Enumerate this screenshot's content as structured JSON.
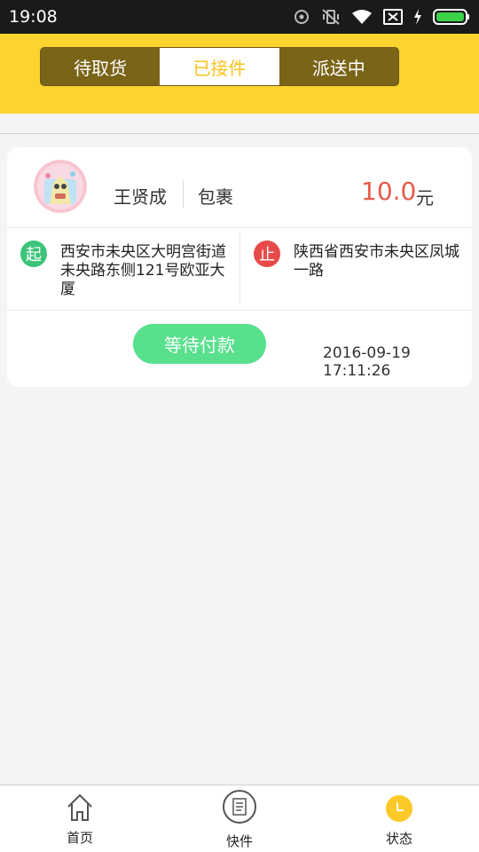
{
  "status_bar": {
    "time": "19:08"
  },
  "tabs": [
    {
      "label": "待取货",
      "active": false
    },
    {
      "label": "已接件",
      "active": true
    },
    {
      "label": "派送中",
      "active": false
    }
  ],
  "order": {
    "name": "王贤成",
    "type": "包裹",
    "price": "10.0",
    "unit": "元",
    "start_badge": "起",
    "start_address": "西安市未央区大明宫街道未央路东侧121号欧亚大厦",
    "end_badge": "止",
    "end_address": "陕西省西安市未央区凤城一路",
    "status_button": "等待付款",
    "timestamp": "2016-09-19 17:11:26"
  },
  "nav": {
    "home": "首页",
    "express": "快件",
    "state": "状态"
  },
  "colors": {
    "header": "#fdd32f",
    "tab_dark": "#7a6418",
    "price": "#e85a4a",
    "start_badge": "#3cc47a",
    "end_badge": "#e84a4a",
    "status_button": "#58e08c",
    "nav_state_icon": "#fdc928"
  },
  "icons": {
    "status_bar": [
      "hotspot-icon",
      "vibrate-off-icon",
      "wifi-icon",
      "no-sim-icon",
      "charging-icon",
      "battery-icon"
    ],
    "nav": [
      "home-icon",
      "receipt-icon",
      "clock-icon"
    ]
  }
}
